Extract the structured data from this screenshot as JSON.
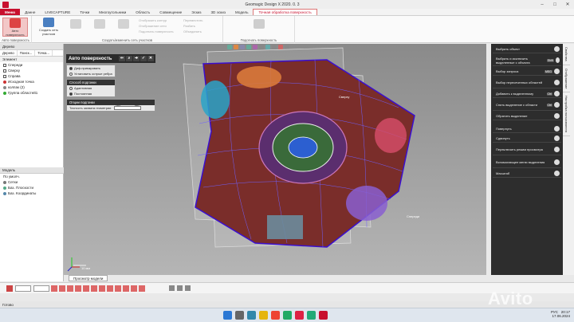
{
  "window": {
    "title": "Geomagic Design X 2020. 0. 3"
  },
  "tabs": [
    "Меню",
    "Данне",
    "LIVECAPTURE",
    "Точки",
    "Многоугольники",
    "Область",
    "Совмещение",
    "Эскиз",
    "3D эскиз",
    "Модель",
    "Точная обработка поверхность"
  ],
  "ribbon": {
    "auto_surface": "Авто поверхность",
    "create_patches": "Создать сеть участков",
    "group1_label": "Авто поверхность",
    "group2_label": "Создать/изменить сеть участков",
    "group3_label": "Подогнать поверхность",
    "small_a": "Отобразить контур",
    "small_b": "Отображение сети",
    "small_c": "Подогнать поверхность",
    "small_d": "Переместить",
    "small_e": "Разбить",
    "small_f": "Объединить"
  },
  "left": {
    "header": "Дерево",
    "tree_tabs": [
      "Дерево",
      "Поиск...",
      "Точка..."
    ],
    "section": "Элемент",
    "items": [
      "Спереди",
      "Сверху",
      "Справа",
      "Исходная точка",
      "колпак (2)",
      "Группа областей1"
    ],
    "model_header": "Модель",
    "model_items": [
      "По умолч.",
      "Сетки",
      "Баз. Плоскости",
      "Баз. Координаты"
    ]
  },
  "auto_panel": {
    "title": "Авто поверхность",
    "opt1": "Диф.примкровать",
    "opt2": "Установить острые ребра",
    "method_header": "Способ подгонки",
    "method1": "Адаптивная",
    "method2": "Постоянная",
    "fit_header": "Опции подгонки",
    "fit_label": "Точность захвата геометрии",
    "fit_min": "Низ.",
    "fit_max": "Выс."
  },
  "viewport": {
    "label_front": "Спереди",
    "label_right": "Сверху",
    "scale": "10 мм"
  },
  "right_panel": {
    "items": [
      {
        "label": "Выбрать объект",
        "key": ""
      },
      {
        "label": "Выбрать и исключить выделенные с объекта",
        "key": "Shift"
      },
      {
        "label": "Выбор запроса",
        "key": "MSG"
      },
      {
        "label": "Выбор пересеченных областей",
        "key": ""
      },
      {
        "label": "Добавить к выделенному",
        "key": "Ctrl"
      },
      {
        "label": "Снять выделение с области",
        "key": "Ctrl"
      },
      {
        "label": "Обратить выделение",
        "key": ""
      },
      {
        "label": "Повернуть",
        "key": ""
      },
      {
        "label": "Сдвинуть",
        "key": ""
      },
      {
        "label": "Переключить режим просмотра",
        "key": ""
      },
      {
        "label": "Вспомогающее меню выделения",
        "key": ""
      },
      {
        "label": "Масштаб",
        "key": ""
      }
    ]
  },
  "sidetabs": [
    "Свойства",
    "Отображение",
    "Настройка пользователя"
  ],
  "viewport_tab": "Просмотр модели",
  "status": "Готово",
  "tray": {
    "time": "20:17",
    "date": "17.06.2024",
    "lang": "РУС"
  },
  "watermark": "Avito",
  "colors": {
    "accent": "#c8102e",
    "viewport_bg": "#9a9a9a",
    "panel_dark": "#2d2d2d"
  }
}
